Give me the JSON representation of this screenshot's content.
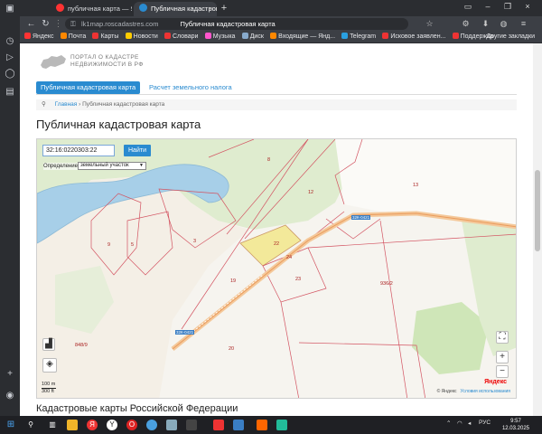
{
  "browser": {
    "tabs": [
      {
        "title": "публичная карта — Янде...",
        "active": false
      },
      {
        "title": "Публичная кадастровая ...",
        "active": true
      }
    ],
    "url": "lk1map.roscadastres.com",
    "page_title": "Публичная кадастровая карта"
  },
  "bookmarks": [
    "Яндекс",
    "Почта",
    "Карты",
    "Новости",
    "Словари",
    "Музыка",
    "Диск",
    "Входящие — Янд...",
    "Telegram",
    "Исковое заявлен...",
    "Поддержка"
  ],
  "bookmarks_right": "Другие закладки",
  "site": {
    "logo_line1": "ПОРТАЛ О КАДАСТРЕ",
    "logo_line2": "НЕДВИЖИМОСТИ В РФ",
    "nav": [
      "Публичная кадастровая карта",
      "Расчет земельного налога"
    ],
    "breadcrumb_home": "Главная",
    "breadcrumb_current": "Публичная кадастровая карта",
    "heading": "Публичная кадастровая карта",
    "subheading": "Кадастровые карты Российской Федерации"
  },
  "map": {
    "search_value": "32:16:0220303:22",
    "find_button": "Найти",
    "definition_label": "Определение:",
    "definition_value": "земельный участок",
    "parcel_labels": [
      "8",
      "12",
      "13",
      "9",
      "5",
      "3",
      "22",
      "24",
      "23",
      "19",
      "936/2",
      "20",
      "848/9"
    ],
    "road_labels": [
      "32К-0421",
      "32К-0421"
    ],
    "scale_top": "100 m",
    "scale_bottom": "300 ft",
    "attribution": "Яндекс",
    "terms_left": "© Яндекс",
    "terms_link": "Условия использования"
  },
  "taskbar": {
    "lang": "РУС",
    "time": "9:57",
    "date": "12.03.2025"
  }
}
